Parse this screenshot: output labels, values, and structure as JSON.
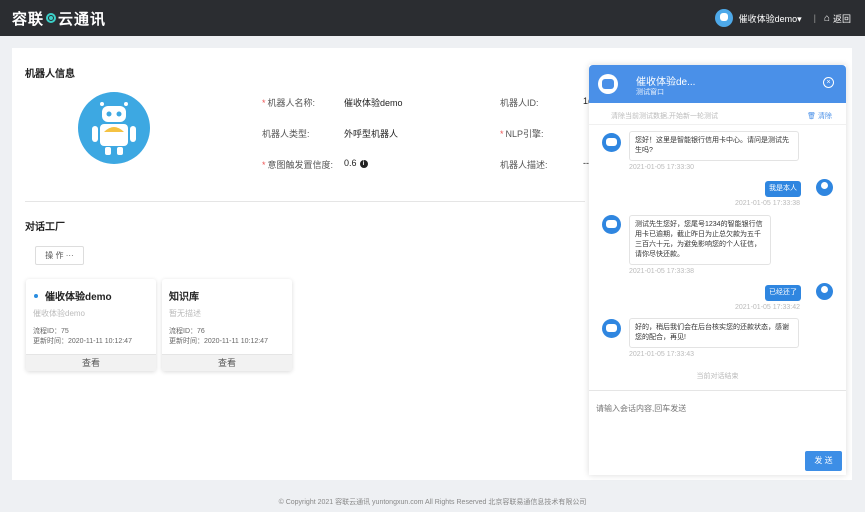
{
  "topbar": {
    "logo_part1": "容联",
    "logo_part2": "云通讯",
    "user": "催收体验demo▾",
    "sep": "|",
    "back": "返回"
  },
  "robot_info": {
    "title": "机器人信息",
    "name_label": "机器人名称:",
    "name_value": "催收体验demo",
    "id_label": "机器人ID:",
    "id_value": "1(",
    "type_label": "机器人类型:",
    "type_value": "外呼型机器人",
    "nlp_label": "NLP引擎:",
    "threshold_label": "意图触发置信度:",
    "threshold_value": "0.6",
    "desc_label": "机器人描述:",
    "desc_value": "--"
  },
  "factory": {
    "title": "对话工厂",
    "op_button": "操 作 ···",
    "cards": [
      {
        "title": "催收体验demo",
        "desc": "催收体验demo",
        "flow_id": "流程ID：75",
        "updated": "更新时间：2020-11-11 10:12:47",
        "view": "查看"
      },
      {
        "title": "知识库",
        "desc": "暂无描述",
        "flow_id": "流程ID：76",
        "updated": "更新时间：2020-11-11 10:12:47",
        "view": "查看"
      }
    ]
  },
  "chat": {
    "name": "催收体验de...",
    "subtitle": "测试窗口",
    "tip": "清除当前测试数据,开始新一轮测试",
    "clear": "清除",
    "messages": [
      {
        "side": "bot",
        "text": "您好！这里是智能银行信用卡中心。请问是测试先生吗?",
        "time": "2021-01-05 17:33:30"
      },
      {
        "side": "user",
        "text": "我是本人",
        "time": "2021-01-05 17:33:38"
      },
      {
        "side": "bot",
        "text": "测试先生您好，您尾号1234的智能银行信用卡已逾期，截止昨日为止总欠款为五千三百六十元，为避免影响您的个人征信，请你尽快还款。",
        "time": "2021-01-05 17:33:38"
      },
      {
        "side": "user",
        "text": "已经还了",
        "time": "2021-01-05 17:33:42"
      },
      {
        "side": "bot",
        "text": "好的，稍后我们会在后台核实您的还款状态，感谢您的配合，再见!",
        "time": "2021-01-05 17:33:43"
      }
    ],
    "end_text": "当前对话结束",
    "input_placeholder": "请输入会话内容,回车发送",
    "send": "发 送"
  },
  "footer": "© Copyright 2021   容联云通讯   yuntongxun.com   All Rights Reserved  北京容联易通信息技术有限公司"
}
